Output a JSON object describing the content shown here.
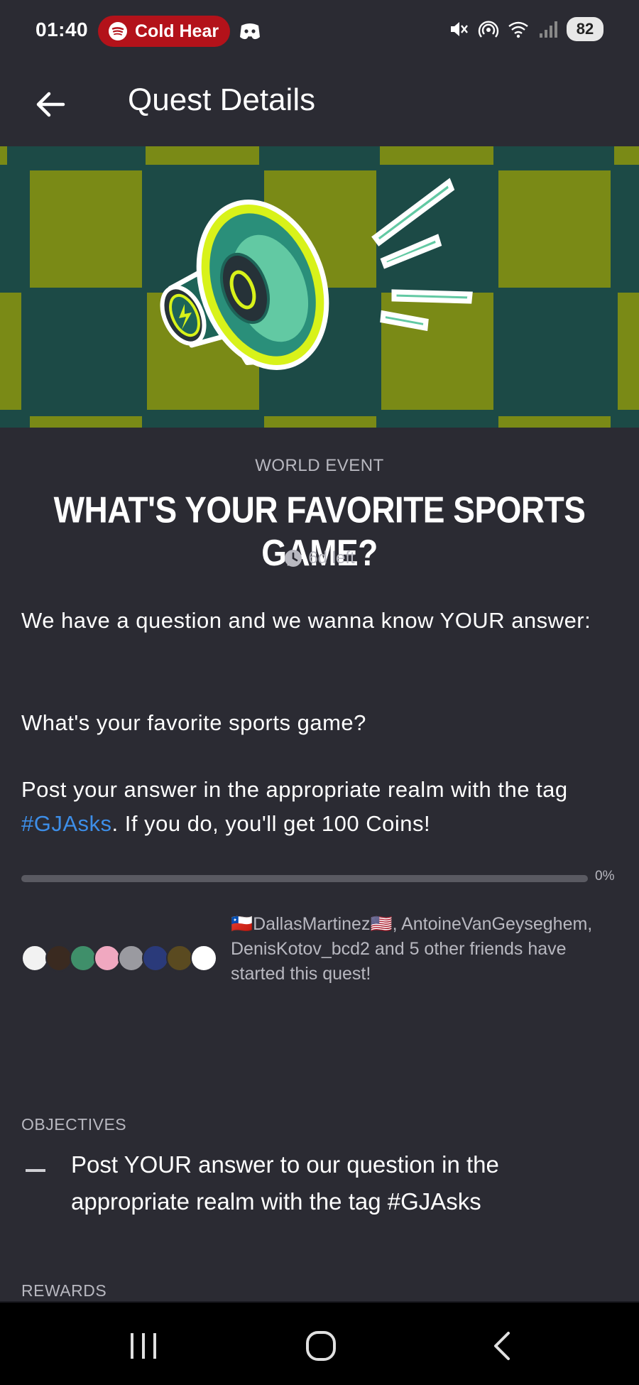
{
  "status_bar": {
    "time": "01:40",
    "media_text": "Cold Hear",
    "battery": "82"
  },
  "app_bar": {
    "title": "Quest Details"
  },
  "quest": {
    "category": "WORLD EVENT",
    "title": "WHAT'S YOUR FAVORITE SPORTS GAME?",
    "time_left": "6d left",
    "paragraph1": "We have a question and we wanna know YOUR answer:",
    "paragraph2": "What's your favorite sports game?",
    "paragraph3_before": "Post your answer in the appropriate realm with the tag ",
    "paragraph3_tag": "#GJAsks",
    "paragraph3_after": ". If you do, you'll get 100 Coins!",
    "progress_label": "0%",
    "progress_fraction": 0,
    "friends_text": "🇨🇱DallasMartinez🇺🇸, AntoineVanGeyseghem, DenisKotov_bcd2 and 5 other friends have started this quest!"
  },
  "objectives": {
    "label": "OBJECTIVES",
    "items": [
      "Post YOUR answer to our question in the appropriate realm with the tag #GJAsks"
    ]
  },
  "rewards": {
    "label": "REWARDS"
  },
  "colors": {
    "background": "#2b2b33",
    "accent_link": "#3d8ee8",
    "banner_dark": "#1c4a46",
    "banner_yellow": "#7a8a16"
  }
}
